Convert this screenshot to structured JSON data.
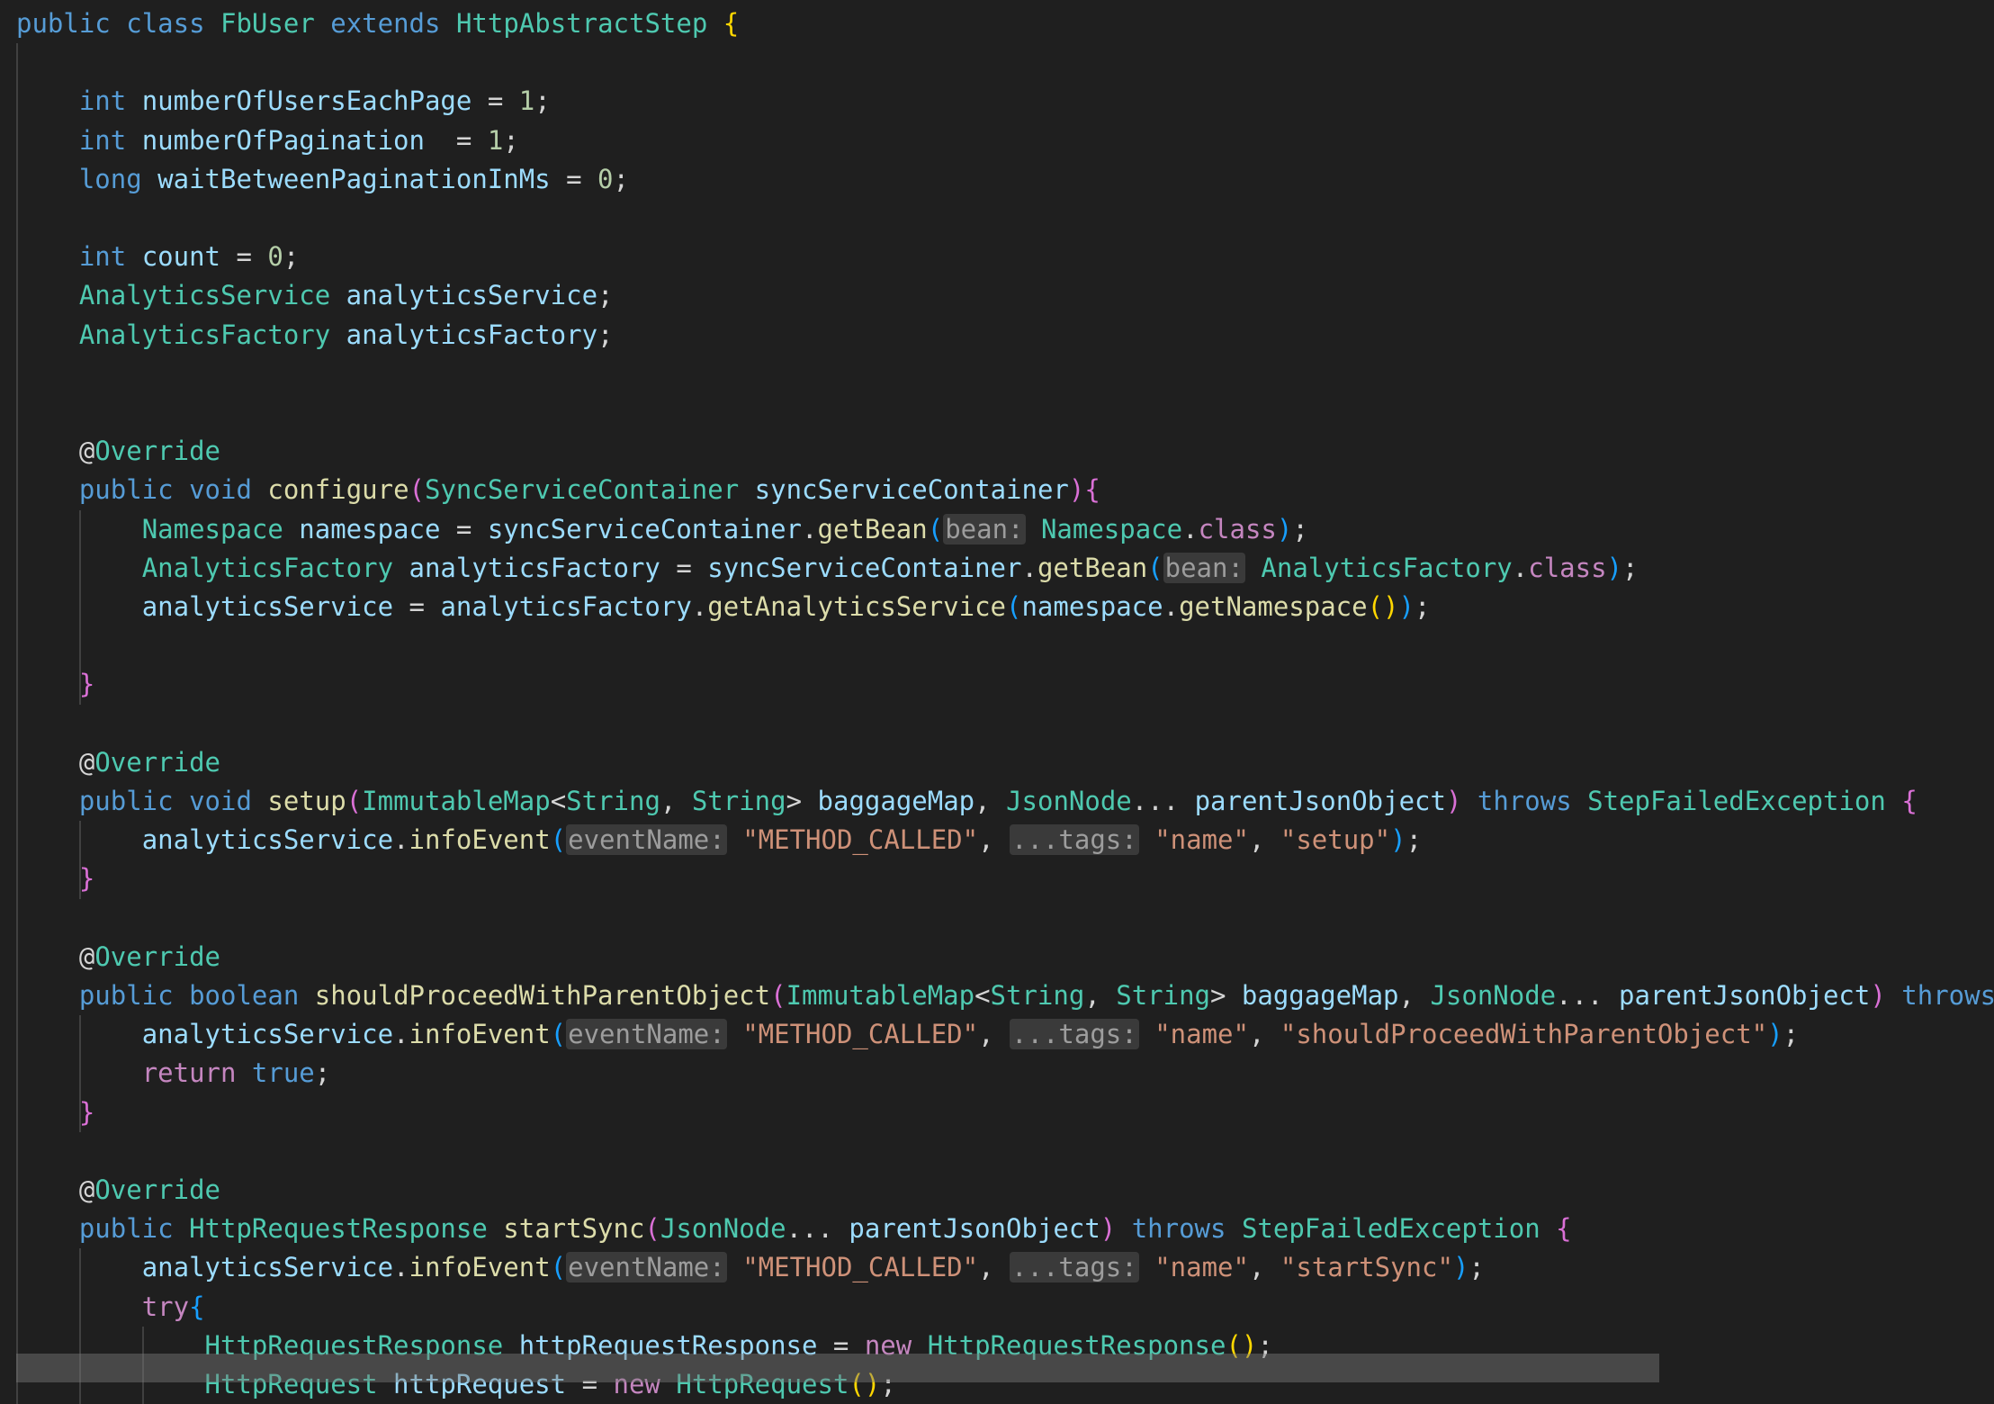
{
  "editor": {
    "language": "Java",
    "theme_colors": {
      "background": "#1f1f1f",
      "keyword": "#569cd6",
      "control": "#c586c0",
      "type": "#4ec9b0",
      "identifier": "#9cdcfe",
      "function": "#dcdcaa",
      "string": "#ce9178",
      "number": "#b5cea8",
      "punctuation": "#d4d4d4",
      "inlay_hint": "#9d9d9d"
    },
    "lines": [
      [
        [
          "public",
          "kw"
        ],
        [
          " ",
          "p"
        ],
        [
          "class",
          "kw"
        ],
        [
          " ",
          "p"
        ],
        [
          "FbUser",
          "ty"
        ],
        [
          " ",
          "p"
        ],
        [
          "extends",
          "kw"
        ],
        [
          " ",
          "p"
        ],
        [
          "HttpAbstractStep",
          "ty"
        ],
        [
          " ",
          "p"
        ],
        [
          "{",
          "br1"
        ]
      ],
      [],
      [
        [
          "    ",
          "p"
        ],
        [
          "int",
          "kw"
        ],
        [
          " ",
          "p"
        ],
        [
          "numberOfUsersEachPage",
          "id"
        ],
        [
          " = ",
          "p"
        ],
        [
          "1",
          "nu"
        ],
        [
          ";",
          "p"
        ]
      ],
      [
        [
          "    ",
          "p"
        ],
        [
          "int",
          "kw"
        ],
        [
          " ",
          "p"
        ],
        [
          "numberOfPagination",
          "id"
        ],
        [
          "  = ",
          "p"
        ],
        [
          "1",
          "nu"
        ],
        [
          ";",
          "p"
        ]
      ],
      [
        [
          "    ",
          "p"
        ],
        [
          "long",
          "kw"
        ],
        [
          " ",
          "p"
        ],
        [
          "waitBetweenPaginationInMs",
          "id"
        ],
        [
          " = ",
          "p"
        ],
        [
          "0",
          "nu"
        ],
        [
          ";",
          "p"
        ]
      ],
      [],
      [
        [
          "    ",
          "p"
        ],
        [
          "int",
          "kw"
        ],
        [
          " ",
          "p"
        ],
        [
          "count",
          "id"
        ],
        [
          " = ",
          "p"
        ],
        [
          "0",
          "nu"
        ],
        [
          ";",
          "p"
        ]
      ],
      [
        [
          "    ",
          "p"
        ],
        [
          "AnalyticsService",
          "ty"
        ],
        [
          " ",
          "p"
        ],
        [
          "analyticsService",
          "id"
        ],
        [
          ";",
          "p"
        ]
      ],
      [
        [
          "    ",
          "p"
        ],
        [
          "AnalyticsFactory",
          "ty"
        ],
        [
          " ",
          "p"
        ],
        [
          "analyticsFactory",
          "id"
        ],
        [
          ";",
          "p"
        ]
      ],
      [],
      [],
      [
        [
          "    ",
          "p"
        ],
        [
          "@",
          "p"
        ],
        [
          "Override",
          "ty"
        ]
      ],
      [
        [
          "    ",
          "p"
        ],
        [
          "public",
          "kw"
        ],
        [
          " ",
          "p"
        ],
        [
          "void",
          "kw"
        ],
        [
          " ",
          "p"
        ],
        [
          "configure",
          "fn"
        ],
        [
          "(",
          "br2"
        ],
        [
          "SyncServiceContainer",
          "ty"
        ],
        [
          " ",
          "p"
        ],
        [
          "syncServiceContainer",
          "id"
        ],
        [
          ")",
          "br2"
        ],
        [
          "{",
          "br2"
        ]
      ],
      [
        [
          "        ",
          "p"
        ],
        [
          "Namespace",
          "ty"
        ],
        [
          " ",
          "p"
        ],
        [
          "namespace",
          "id"
        ],
        [
          " = ",
          "p"
        ],
        [
          "syncServiceContainer",
          "id"
        ],
        [
          ".",
          "p"
        ],
        [
          "getBean",
          "fn"
        ],
        [
          "(",
          "br3"
        ],
        [
          "bean:",
          "hint"
        ],
        [
          " ",
          "p"
        ],
        [
          "Namespace",
          "ty"
        ],
        [
          ".",
          "p"
        ],
        [
          "class",
          "ct"
        ],
        [
          ")",
          "br3"
        ],
        [
          ";",
          "p"
        ]
      ],
      [
        [
          "        ",
          "p"
        ],
        [
          "AnalyticsFactory",
          "ty"
        ],
        [
          " ",
          "p"
        ],
        [
          "analyticsFactory",
          "id"
        ],
        [
          " = ",
          "p"
        ],
        [
          "syncServiceContainer",
          "id"
        ],
        [
          ".",
          "p"
        ],
        [
          "getBean",
          "fn"
        ],
        [
          "(",
          "br3"
        ],
        [
          "bean:",
          "hint"
        ],
        [
          " ",
          "p"
        ],
        [
          "AnalyticsFactory",
          "ty"
        ],
        [
          ".",
          "p"
        ],
        [
          "class",
          "ct"
        ],
        [
          ")",
          "br3"
        ],
        [
          ";",
          "p"
        ]
      ],
      [
        [
          "        ",
          "p"
        ],
        [
          "analyticsService",
          "id"
        ],
        [
          " = ",
          "p"
        ],
        [
          "analyticsFactory",
          "id"
        ],
        [
          ".",
          "p"
        ],
        [
          "getAnalyticsService",
          "fn"
        ],
        [
          "(",
          "br3"
        ],
        [
          "namespace",
          "id"
        ],
        [
          ".",
          "p"
        ],
        [
          "getNamespace",
          "fn"
        ],
        [
          "()",
          "br1"
        ],
        [
          ")",
          "br3"
        ],
        [
          ";",
          "p"
        ]
      ],
      [],
      [
        [
          "    ",
          "p"
        ],
        [
          "}",
          "br2"
        ]
      ],
      [],
      [
        [
          "    ",
          "p"
        ],
        [
          "@",
          "p"
        ],
        [
          "Override",
          "ty"
        ]
      ],
      [
        [
          "    ",
          "p"
        ],
        [
          "public",
          "kw"
        ],
        [
          " ",
          "p"
        ],
        [
          "void",
          "kw"
        ],
        [
          " ",
          "p"
        ],
        [
          "setup",
          "fn"
        ],
        [
          "(",
          "br2"
        ],
        [
          "ImmutableMap",
          "ty"
        ],
        [
          "<",
          "p"
        ],
        [
          "String",
          "ty"
        ],
        [
          ", ",
          "p"
        ],
        [
          "String",
          "ty"
        ],
        [
          "> ",
          "p"
        ],
        [
          "baggageMap",
          "id"
        ],
        [
          ", ",
          "p"
        ],
        [
          "JsonNode",
          "ty"
        ],
        [
          "... ",
          "p"
        ],
        [
          "parentJsonObject",
          "id"
        ],
        [
          ")",
          "br2"
        ],
        [
          " ",
          "p"
        ],
        [
          "throws",
          "kw"
        ],
        [
          " ",
          "p"
        ],
        [
          "StepFailedException",
          "ty"
        ],
        [
          " ",
          "p"
        ],
        [
          "{",
          "br2"
        ]
      ],
      [
        [
          "        ",
          "p"
        ],
        [
          "analyticsService",
          "id"
        ],
        [
          ".",
          "p"
        ],
        [
          "infoEvent",
          "fn"
        ],
        [
          "(",
          "br3"
        ],
        [
          "eventName:",
          "hint"
        ],
        [
          " ",
          "p"
        ],
        [
          "\"METHOD_CALLED\"",
          "st"
        ],
        [
          ", ",
          "p"
        ],
        [
          "...tags:",
          "hint"
        ],
        [
          " ",
          "p"
        ],
        [
          "\"name\"",
          "st"
        ],
        [
          ", ",
          "p"
        ],
        [
          "\"setup\"",
          "st"
        ],
        [
          ")",
          "br3"
        ],
        [
          ";",
          "p"
        ]
      ],
      [
        [
          "    ",
          "p"
        ],
        [
          "}",
          "br2"
        ]
      ],
      [],
      [
        [
          "    ",
          "p"
        ],
        [
          "@",
          "p"
        ],
        [
          "Override",
          "ty"
        ]
      ],
      [
        [
          "    ",
          "p"
        ],
        [
          "public",
          "kw"
        ],
        [
          " ",
          "p"
        ],
        [
          "boolean",
          "kw"
        ],
        [
          " ",
          "p"
        ],
        [
          "shouldProceedWithParentObject",
          "fn"
        ],
        [
          "(",
          "br2"
        ],
        [
          "ImmutableMap",
          "ty"
        ],
        [
          "<",
          "p"
        ],
        [
          "String",
          "ty"
        ],
        [
          ", ",
          "p"
        ],
        [
          "String",
          "ty"
        ],
        [
          "> ",
          "p"
        ],
        [
          "baggageMap",
          "id"
        ],
        [
          ", ",
          "p"
        ],
        [
          "JsonNode",
          "ty"
        ],
        [
          "... ",
          "p"
        ],
        [
          "parentJsonObject",
          "id"
        ],
        [
          ")",
          "br2"
        ],
        [
          " ",
          "p"
        ],
        [
          "throws",
          "kw"
        ]
      ],
      [
        [
          "        ",
          "p"
        ],
        [
          "analyticsService",
          "id"
        ],
        [
          ".",
          "p"
        ],
        [
          "infoEvent",
          "fn"
        ],
        [
          "(",
          "br3"
        ],
        [
          "eventName:",
          "hint"
        ],
        [
          " ",
          "p"
        ],
        [
          "\"METHOD_CALLED\"",
          "st"
        ],
        [
          ", ",
          "p"
        ],
        [
          "...tags:",
          "hint"
        ],
        [
          " ",
          "p"
        ],
        [
          "\"name\"",
          "st"
        ],
        [
          ", ",
          "p"
        ],
        [
          "\"shouldProceedWithParentObject\"",
          "st"
        ],
        [
          ")",
          "br3"
        ],
        [
          ";",
          "p"
        ]
      ],
      [
        [
          "        ",
          "p"
        ],
        [
          "return",
          "ct"
        ],
        [
          " ",
          "p"
        ],
        [
          "true",
          "kw"
        ],
        [
          ";",
          "p"
        ]
      ],
      [
        [
          "    ",
          "p"
        ],
        [
          "}",
          "br2"
        ]
      ],
      [],
      [
        [
          "    ",
          "p"
        ],
        [
          "@",
          "p"
        ],
        [
          "Override",
          "ty"
        ]
      ],
      [
        [
          "    ",
          "p"
        ],
        [
          "public",
          "kw"
        ],
        [
          " ",
          "p"
        ],
        [
          "HttpRequestResponse",
          "ty"
        ],
        [
          " ",
          "p"
        ],
        [
          "startSync",
          "fn"
        ],
        [
          "(",
          "br2"
        ],
        [
          "JsonNode",
          "ty"
        ],
        [
          "... ",
          "p"
        ],
        [
          "parentJsonObject",
          "id"
        ],
        [
          ")",
          "br2"
        ],
        [
          " ",
          "p"
        ],
        [
          "throws",
          "kw"
        ],
        [
          " ",
          "p"
        ],
        [
          "StepFailedException",
          "ty"
        ],
        [
          " ",
          "p"
        ],
        [
          "{",
          "br2"
        ]
      ],
      [
        [
          "        ",
          "p"
        ],
        [
          "analyticsService",
          "id"
        ],
        [
          ".",
          "p"
        ],
        [
          "infoEvent",
          "fn"
        ],
        [
          "(",
          "br3"
        ],
        [
          "eventName:",
          "hint"
        ],
        [
          " ",
          "p"
        ],
        [
          "\"METHOD_CALLED\"",
          "st"
        ],
        [
          ", ",
          "p"
        ],
        [
          "...tags:",
          "hint"
        ],
        [
          " ",
          "p"
        ],
        [
          "\"name\"",
          "st"
        ],
        [
          ", ",
          "p"
        ],
        [
          "\"startSync\"",
          "st"
        ],
        [
          ")",
          "br3"
        ],
        [
          ";",
          "p"
        ]
      ],
      [
        [
          "        ",
          "p"
        ],
        [
          "try",
          "ct"
        ],
        [
          "{",
          "br3"
        ]
      ],
      [
        [
          "            ",
          "p"
        ],
        [
          "HttpRequestResponse",
          "ty"
        ],
        [
          " ",
          "p"
        ],
        [
          "httpRequestResponse",
          "id"
        ],
        [
          " = ",
          "p"
        ],
        [
          "new",
          "ct"
        ],
        [
          " ",
          "p"
        ],
        [
          "HttpRequestResponse",
          "ty"
        ],
        [
          "()",
          "br1"
        ],
        [
          ";",
          "p"
        ]
      ],
      [
        [
          "            ",
          "p"
        ],
        [
          "HttpRequest",
          "ty"
        ],
        [
          " ",
          "p"
        ],
        [
          "httpRequest",
          "id"
        ],
        [
          " = ",
          "p"
        ],
        [
          "new",
          "ct"
        ],
        [
          " ",
          "p"
        ],
        [
          "HttpRequest",
          "ty"
        ],
        [
          "()",
          "br1"
        ],
        [
          ";",
          "p"
        ]
      ]
    ]
  }
}
